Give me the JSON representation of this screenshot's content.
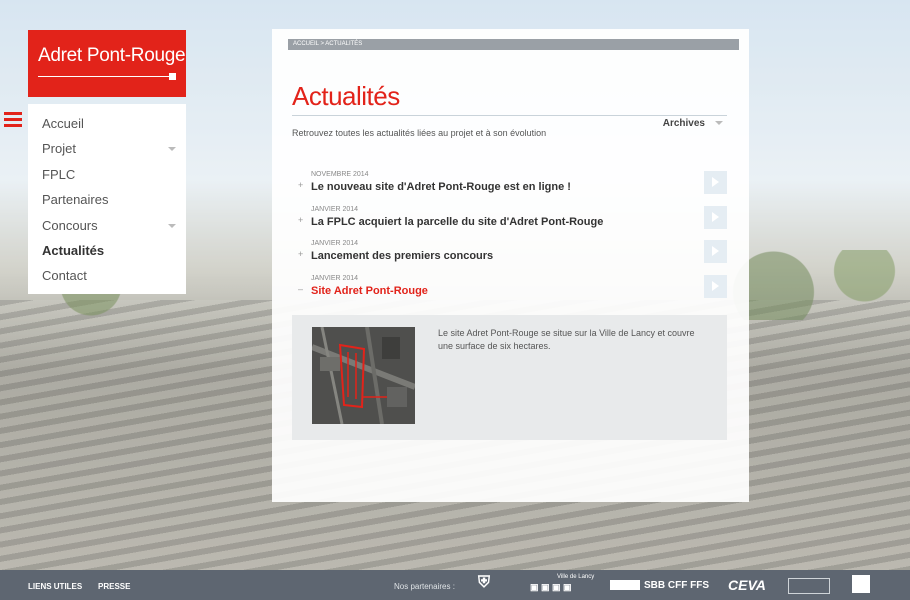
{
  "logo": {
    "text": "Adret Pont-Rouge"
  },
  "nav": {
    "items": [
      {
        "label": "Accueil",
        "chevron": false,
        "active": false
      },
      {
        "label": "Projet",
        "chevron": true,
        "active": false
      },
      {
        "label": "FPLC",
        "chevron": false,
        "active": false
      },
      {
        "label": "Partenaires",
        "chevron": false,
        "active": false
      },
      {
        "label": "Concours",
        "chevron": true,
        "active": false
      },
      {
        "label": "Actualités",
        "chevron": false,
        "active": true
      },
      {
        "label": "Contact",
        "chevron": false,
        "active": false
      }
    ]
  },
  "breadcrumb": "ACCUEIL > ACTUALITÉS",
  "page": {
    "title": "Actualités",
    "subtitle": "Retrouvez toutes les actualités liées au projet et à son évolution",
    "archives_label": "Archives"
  },
  "news": [
    {
      "sign": "+",
      "date": "NOVEMBRE 2014",
      "title": "Le nouveau site d'Adret Pont-Rouge est en ligne !",
      "open": false
    },
    {
      "sign": "+",
      "date": "JANVIER 2014",
      "title": "La FPLC acquiert la parcelle du site d'Adret Pont-Rouge",
      "open": false
    },
    {
      "sign": "+",
      "date": "JANVIER 2014",
      "title": "Lancement des premiers concours",
      "open": false
    },
    {
      "sign": "–",
      "date": "JANVIER 2014",
      "title": "Site Adret Pont-Rouge",
      "open": true
    }
  ],
  "detail": {
    "text": "Le site Adret Pont-Rouge se situe sur la Ville de Lancy et couvre une surface de six hectares."
  },
  "footer": {
    "links": [
      "LIENS UTILES",
      "PRESSE"
    ],
    "partners_label": "Nos partenaires :",
    "ville_label": "Ville de Lancy",
    "sbb": "SBB CFF FFS",
    "ceva": "CEVA"
  },
  "colors": {
    "brand": "#e2231a",
    "footer": "#5e6671"
  }
}
